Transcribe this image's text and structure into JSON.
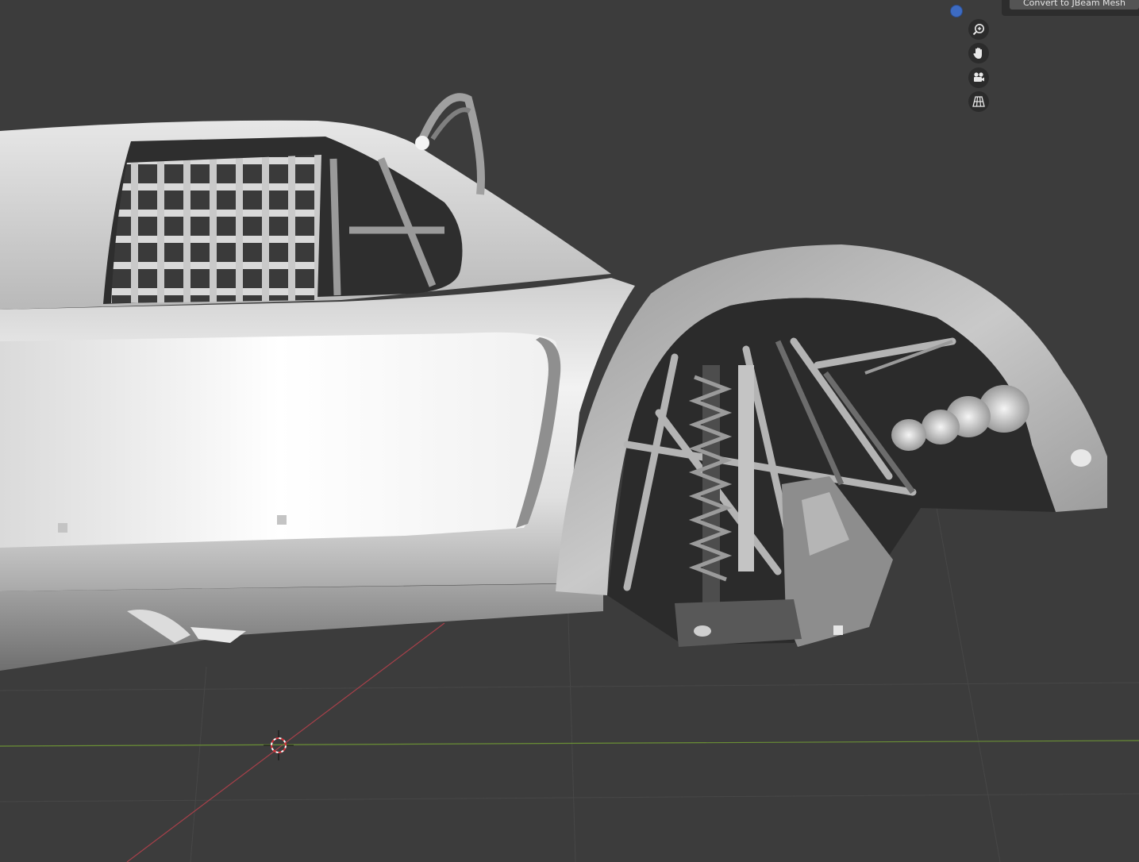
{
  "viewport": {
    "background": "#3c3c3c",
    "x_axis_color": "#a8404a",
    "y_axis_color": "#6a8f35"
  },
  "navigation": {
    "gizmo_dot_color": "#3d6bc2",
    "buttons": [
      {
        "name": "zoom-icon"
      },
      {
        "name": "hand-icon"
      },
      {
        "name": "camera-icon"
      },
      {
        "name": "grid-icon"
      }
    ]
  },
  "operator": {
    "convert_label": "Convert to JBeam Mesh"
  },
  "scene": {
    "object": "car-body-model",
    "cursor": "3d-cursor"
  }
}
